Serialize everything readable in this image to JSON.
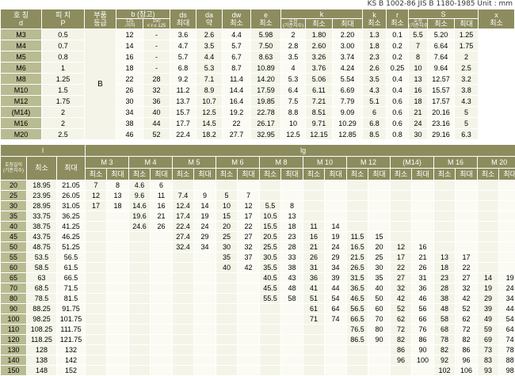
{
  "caption": "KS B 1002-86   JIS B 1180-1985   Unit : mm",
  "top_table": {
    "header_row1": [
      "호 칭\nd",
      "피 치\nP",
      "부품\n등급",
      "b (참고)",
      "ds\n최대",
      "da\n약",
      "dw\n최소",
      "e\n최소",
      "k",
      "k\n최소",
      "r\n최소",
      "S",
      "x\n최소"
    ],
    "b_sub": [
      "125\n↓이하",
      "150\n< ℓ ≤ 125"
    ],
    "k_sub": [
      "호칭\n(기준치수)",
      "최소",
      "최대"
    ],
    "s_sub": [
      "호칭\n(기준치수)",
      "최소",
      "최대"
    ],
    "grade": "B",
    "rows": [
      [
        "M3",
        "0.5",
        "12",
        "-",
        "3.6",
        "2.6",
        "4.4",
        "5.98",
        "2",
        "1.80",
        "2.20",
        "1.3",
        "0.1",
        "5.5",
        "5.20",
        "1.25"
      ],
      [
        "M4",
        "0.7",
        "14",
        "-",
        "4.7",
        "3.5",
        "5.7",
        "7.50",
        "2.8",
        "2.60",
        "3.00",
        "1.8",
        "0.2",
        "7",
        "6.64",
        "1.75"
      ],
      [
        "M5",
        "0.8",
        "16",
        "-",
        "5.7",
        "4.4",
        "6.7",
        "8.63",
        "3.5",
        "3.26",
        "3.74",
        "2.3",
        "0.2",
        "8",
        "7.64",
        "2"
      ],
      [
        "M6",
        "1",
        "18",
        "-",
        "6.8",
        "5.3",
        "8.7",
        "10.89",
        "4",
        "3.76",
        "4.24",
        "2.6",
        "0.25",
        "10",
        "9.64",
        "2.5"
      ],
      [
        "M8",
        "1.25",
        "22",
        "28",
        "9.2",
        "7.1",
        "11.4",
        "14.20",
        "5.3",
        "5.06",
        "5.54",
        "3.5",
        "0.4",
        "13",
        "12.57",
        "3.2"
      ],
      [
        "M10",
        "1.5",
        "26",
        "32",
        "11.2",
        "8.9",
        "14.4",
        "17.59",
        "6.4",
        "6.11",
        "6.69",
        "4.3",
        "0.4",
        "16",
        "15.57",
        "3.8"
      ],
      [
        "M12",
        "1.75",
        "30",
        "36",
        "13.7",
        "10.7",
        "16.4",
        "19.85",
        "7.5",
        "7.21",
        "7.79",
        "5.1",
        "0.6",
        "18",
        "17.57",
        "4.3"
      ],
      [
        "(M14)",
        "2",
        "34",
        "40",
        "15.7",
        "12.5",
        "19.2",
        "22.78",
        "8.8",
        "8.51",
        "9.09",
        "6",
        "0.6",
        "21",
        "20.16",
        "5"
      ],
      [
        "M16",
        "2",
        "38",
        "44",
        "17.7",
        "14.5",
        "22",
        "26.17",
        "10",
        "9.71",
        "10.29",
        "6.8",
        "0.6",
        "24",
        "23.16",
        "5"
      ],
      [
        "M20",
        "2.5",
        "46",
        "52",
        "22.4",
        "18.2",
        "27.7",
        "32.95",
        "12.5",
        "12.15",
        "12.85",
        "8.5",
        "0.8",
        "30",
        "29.16",
        "6.3"
      ]
    ]
  },
  "bottom_table": {
    "l_label": "l",
    "lg_label": "lg",
    "l_sub": [
      "호칭길이\n(기준치수)",
      "최소",
      "최대"
    ],
    "sizes": [
      "M 3",
      "M 4",
      "M 5",
      "M 6",
      "M 8",
      "M 10",
      "M 12",
      "(M14)",
      "M 16",
      "M 20"
    ],
    "min_label": "최소",
    "max_label": "최대",
    "rows": [
      [
        "20",
        "18.95",
        "21.05",
        "7",
        "8",
        "4.6",
        "6",
        "",
        "",
        "",
        "",
        "",
        "",
        "",
        "",
        "",
        "",
        "",
        "",
        "",
        "",
        "",
        ""
      ],
      [
        "25",
        "23.95",
        "26.05",
        "12",
        "13",
        "9.6",
        "11",
        "7.4",
        "9",
        "5",
        "7",
        "",
        "",
        "",
        "",
        "",
        "",
        "",
        "",
        "",
        "",
        "",
        ""
      ],
      [
        "30",
        "28.95",
        "31.05",
        "17",
        "18",
        "14.6",
        "16",
        "12.4",
        "14",
        "10",
        "12",
        "5.5",
        "8",
        "",
        "",
        "",
        "",
        "",
        "",
        "",
        "",
        "",
        ""
      ],
      [
        "35",
        "33.75",
        "36.25",
        "",
        "",
        "19.6",
        "21",
        "17.4",
        "19",
        "15",
        "17",
        "10.5",
        "13",
        "",
        "",
        "",
        "",
        "",
        "",
        "",
        "",
        "",
        ""
      ],
      [
        "40",
        "38.75",
        "41.25",
        "",
        "",
        "24.6",
        "26",
        "22.4",
        "24",
        "20",
        "22",
        "15.5",
        "18",
        "11",
        "14",
        "",
        "",
        "",
        "",
        "",
        "",
        "",
        ""
      ],
      [
        "45",
        "43.75",
        "46.25",
        "",
        "",
        "",
        "",
        "27.4",
        "29",
        "25",
        "27",
        "20.5",
        "23",
        "16",
        "19",
        "11.5",
        "15",
        "",
        "",
        "",
        "",
        "",
        ""
      ],
      [
        "50",
        "48.75",
        "51.25",
        "",
        "",
        "",
        "",
        "32.4",
        "34",
        "30",
        "32",
        "25.5",
        "28",
        "21",
        "24",
        "16.5",
        "20",
        "12",
        "16",
        "",
        "",
        "",
        ""
      ],
      [
        "55",
        "53.5",
        "56.5",
        "",
        "",
        "",
        "",
        "",
        "",
        "35",
        "37",
        "30.5",
        "33",
        "26",
        "29",
        "21.5",
        "25",
        "17",
        "21",
        "13",
        "17",
        "",
        ""
      ],
      [
        "60",
        "58.5",
        "61.5",
        "",
        "",
        "",
        "",
        "",
        "",
        "40",
        "42",
        "35.5",
        "38",
        "31",
        "34",
        "26.5",
        "30",
        "22",
        "26",
        "18",
        "22",
        "",
        ""
      ],
      [
        "65",
        "63",
        "66.5",
        "",
        "",
        "",
        "",
        "",
        "",
        "",
        "",
        "40.5",
        "43",
        "36",
        "39",
        "31.5",
        "35",
        "27",
        "31",
        "23",
        "27",
        "14",
        "19"
      ],
      [
        "70",
        "68.5",
        "71.5",
        "",
        "",
        "",
        "",
        "",
        "",
        "",
        "",
        "45.5",
        "48",
        "41",
        "44",
        "36.5",
        "40",
        "32",
        "36",
        "28",
        "32",
        "19",
        "24"
      ],
      [
        "80",
        "78.5",
        "81.5",
        "",
        "",
        "",
        "",
        "",
        "",
        "",
        "",
        "55.5",
        "58",
        "51",
        "54",
        "46.5",
        "50",
        "42",
        "46",
        "38",
        "42",
        "29",
        "34"
      ],
      [
        "90",
        "88.25",
        "91.75",
        "",
        "",
        "",
        "",
        "",
        "",
        "",
        "",
        "",
        "",
        "61",
        "64",
        "56.5",
        "60",
        "52",
        "56",
        "48",
        "52",
        "39",
        "44"
      ],
      [
        "100",
        "98.25",
        "101.75",
        "",
        "",
        "",
        "",
        "",
        "",
        "",
        "",
        "",
        "",
        "71",
        "74",
        "66.5",
        "70",
        "62",
        "66",
        "58",
        "62",
        "49",
        "54"
      ],
      [
        "110",
        "108.25",
        "111.75",
        "",
        "",
        "",
        "",
        "",
        "",
        "",
        "",
        "",
        "",
        "",
        "",
        "76.5",
        "80",
        "72",
        "76",
        "68",
        "72",
        "59",
        "64"
      ],
      [
        "120",
        "118.25",
        "121.75",
        "",
        "",
        "",
        "",
        "",
        "",
        "",
        "",
        "",
        "",
        "",
        "",
        "86.5",
        "90",
        "82",
        "86",
        "78",
        "82",
        "69",
        "74"
      ],
      [
        "130",
        "128",
        "132",
        "",
        "",
        "",
        "",
        "",
        "",
        "",
        "",
        "",
        "",
        "",
        "",
        "",
        "",
        "86",
        "90",
        "82",
        "86",
        "73",
        "78"
      ],
      [
        "140",
        "138",
        "142",
        "",
        "",
        "",
        "",
        "",
        "",
        "",
        "",
        "",
        "",
        "",
        "",
        "",
        "",
        "96",
        "100",
        "92",
        "96",
        "83",
        "88"
      ],
      [
        "150",
        "148",
        "152",
        "",
        "",
        "",
        "",
        "",
        "",
        "",
        "",
        "",
        "",
        "",
        "",
        "",
        "",
        "",
        "",
        "102",
        "106",
        "93",
        "98"
      ]
    ]
  }
}
